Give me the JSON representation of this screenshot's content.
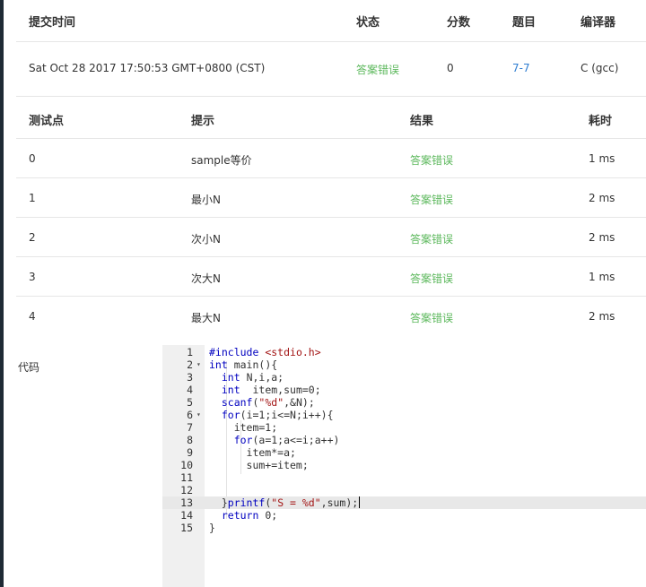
{
  "submission": {
    "headers": {
      "time": "提交时间",
      "status": "状态",
      "score": "分数",
      "problem": "题目",
      "compiler": "编译器"
    },
    "row": {
      "time": "Sat Oct 28 2017 17:50:53 GMT+0800 (CST)",
      "status": "答案错误",
      "score": "0",
      "problem": "7-7",
      "compiler": "C (gcc)"
    }
  },
  "cases": {
    "headers": {
      "id": "测试点",
      "hint": "提示",
      "result": "结果",
      "time": "耗时"
    },
    "rows": [
      {
        "id": "0",
        "hint": "sample等价",
        "result": "答案错误",
        "time": "1 ms"
      },
      {
        "id": "1",
        "hint": "最小N",
        "result": "答案错误",
        "time": "2 ms"
      },
      {
        "id": "2",
        "hint": "次小N",
        "result": "答案错误",
        "time": "2 ms"
      },
      {
        "id": "3",
        "hint": "次大N",
        "result": "答案错误",
        "time": "1 ms"
      },
      {
        "id": "4",
        "hint": "最大N",
        "result": "答案错误",
        "time": "2 ms"
      }
    ]
  },
  "code": {
    "label": "代码",
    "active_line": 13,
    "lines": [
      {
        "n": "1",
        "text": "#include <stdio.h>"
      },
      {
        "n": "2",
        "text": "int main(){"
      },
      {
        "n": "3",
        "text": "  int N,i,a;"
      },
      {
        "n": "4",
        "text": "  int  item,sum=0;"
      },
      {
        "n": "5",
        "text": "  scanf(\"%d\",&N);"
      },
      {
        "n": "6",
        "text": "  for(i=1;i<=N;i++){"
      },
      {
        "n": "7",
        "text": "    item=1;"
      },
      {
        "n": "8",
        "text": "    for(a=1;a<=i;a++)"
      },
      {
        "n": "9",
        "text": "      item*=a;"
      },
      {
        "n": "10",
        "text": "      sum+=item;"
      },
      {
        "n": "11",
        "text": ""
      },
      {
        "n": "12",
        "text": ""
      },
      {
        "n": "13",
        "text": "  }printf(\"S = %d\",sum);"
      },
      {
        "n": "14",
        "text": "  return 0;"
      },
      {
        "n": "15",
        "text": "}"
      }
    ]
  },
  "colors": {
    "status_error": "#5cb85c",
    "link": "#2e7dd1",
    "sidebar": "#1f2a35"
  }
}
